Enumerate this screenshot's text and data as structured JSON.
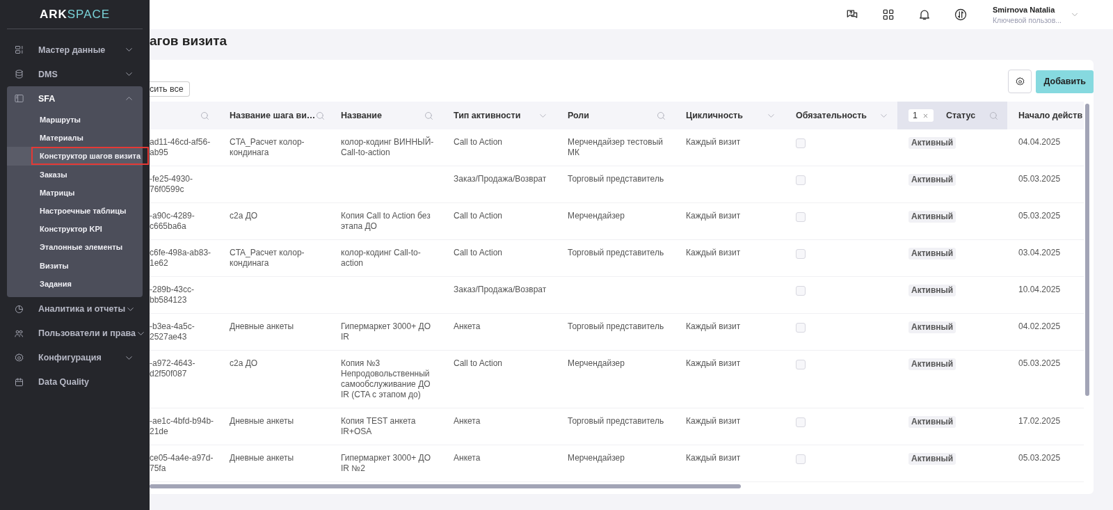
{
  "sidebar": {
    "logo": {
      "text": "ARK",
      "accent": "SPACE"
    },
    "items": [
      {
        "label": "Мастер данные",
        "expanded": false
      },
      {
        "label": "DMS",
        "expanded": false
      },
      {
        "label": "SFA",
        "expanded": true,
        "children": [
          {
            "label": "Маршруты",
            "selected": false
          },
          {
            "label": "Материалы",
            "selected": false
          },
          {
            "label": "Конструктор шагов визита",
            "selected": true
          },
          {
            "label": "Заказы",
            "selected": false
          },
          {
            "label": "Матрицы",
            "selected": false
          },
          {
            "label": "Настроечные таблицы",
            "selected": false
          },
          {
            "label": "Конструктор KPI",
            "selected": false
          },
          {
            "label": "Эталонные элементы",
            "selected": false
          },
          {
            "label": "Визиты",
            "selected": false
          },
          {
            "label": "Задания",
            "selected": false
          }
        ]
      },
      {
        "label": "Аналитика и отчеты",
        "expanded": false
      },
      {
        "label": "Пользователи и права",
        "expanded": false
      },
      {
        "label": "Конфигурация",
        "expanded": false
      },
      {
        "label": "Data Quality"
      }
    ]
  },
  "header": {
    "user": {
      "name": "Smirnova Natalia",
      "role": "Ключевой пользов..."
    }
  },
  "page": {
    "title": "агов визита"
  },
  "toolbar": {
    "clear_button": "сить все",
    "add_button": "Добавить"
  },
  "table": {
    "columns": [
      {
        "kind": "search",
        "filtered": false
      },
      {
        "label": "Название шага ви…",
        "kind": "search",
        "filtered": false
      },
      {
        "label": "Название",
        "kind": "search",
        "filtered": false
      },
      {
        "label": "Тип активности",
        "kind": "dropdown",
        "filtered": false
      },
      {
        "label": "Роли",
        "kind": "search",
        "filtered": false
      },
      {
        "label": "Цикличность",
        "kind": "dropdown",
        "filtered": false
      },
      {
        "label": "Обязательность",
        "kind": "dropdown",
        "filtered": false
      },
      {
        "label": "Статус",
        "kind": "search",
        "filtered": true,
        "filter_count": "1"
      },
      {
        "label": "Начало действ"
      }
    ],
    "rows": [
      {
        "id": "ad11-46cd-af56-\nab95",
        "step_name": "CTA_Расчет колор-кондинага",
        "name": "колор-кодинг ВИННЫЙ-Call-to-action",
        "activity_type": "Call to Action",
        "roles": "Мерчендайзер тестовый МК",
        "cyclicity": "Каждый визит",
        "mandatory": false,
        "status": "Активный",
        "start": "04.04.2025"
      },
      {
        "id": "-fe25-4930-\n76f0599c",
        "step_name": "",
        "name": "",
        "activity_type": "Заказ/Продажа/Возврат",
        "roles": "Торговый представитель",
        "cyclicity": "",
        "mandatory": false,
        "status": "Активный",
        "start": "05.03.2025"
      },
      {
        "id": "-a90c-4289-\nc665ba6a",
        "step_name": "c2a ДО",
        "name": "Копия Call to Action без этапа ДО",
        "activity_type": "Call to Action",
        "roles": "Мерчендайзер",
        "cyclicity": "Каждый визит",
        "mandatory": false,
        "status": "Активный",
        "start": "05.03.2025"
      },
      {
        "id": "c6fe-498a-ab83-\n1e62",
        "step_name": "CTA_Расчет колор-кондинага",
        "name": "колор-кодинг Call-to-action",
        "activity_type": "Call to Action",
        "roles": "Торговый представитель",
        "cyclicity": "Каждый визит",
        "mandatory": false,
        "status": "Активный",
        "start": "03.04.2025"
      },
      {
        "id": "-289b-43cc-\nbb584123",
        "step_name": "",
        "name": "",
        "activity_type": "Заказ/Продажа/Возврат",
        "roles": "",
        "cyclicity": "",
        "mandatory": false,
        "status": "Активный",
        "start": "10.04.2025"
      },
      {
        "id": "-b3ea-4a5c-\n2527ae43",
        "step_name": "Дневные анкеты",
        "name": "Гипермаркет 3000+ ДО IR",
        "activity_type": "Анкета",
        "roles": "Торговый представитель",
        "cyclicity": "Каждый визит",
        "mandatory": false,
        "status": "Активный",
        "start": "04.02.2025"
      },
      {
        "id": "-a972-4643-\nd2f50f087",
        "step_name": "c2a ДО",
        "name": "Копия №3 Непродовольственный самообслуживание ДО IR (CTA с этапом до)",
        "activity_type": "Call to Action",
        "roles": "Мерчендайзер",
        "cyclicity": "Каждый визит",
        "mandatory": false,
        "status": "Активный",
        "start": "05.03.2025"
      },
      {
        "id": "-ae1c-4bfd-b94b-\n21de",
        "step_name": "Дневные анкеты",
        "name": "Копия TEST анкета IR+OSA",
        "activity_type": "Анкета",
        "roles": "Торговый представитель",
        "cyclicity": "Каждый визит",
        "mandatory": false,
        "status": "Активный",
        "start": "17.02.2025"
      },
      {
        "id": "ce05-4a4e-a97d-\n75fa",
        "step_name": "Дневные анкеты",
        "name": "Гипермаркет 3000+ ДО IR №2",
        "activity_type": "Анкета",
        "roles": "Мерчендайзер",
        "cyclicity": "Каждый визит",
        "mandatory": false,
        "status": "Активный",
        "start": "05.03.2025"
      }
    ]
  }
}
